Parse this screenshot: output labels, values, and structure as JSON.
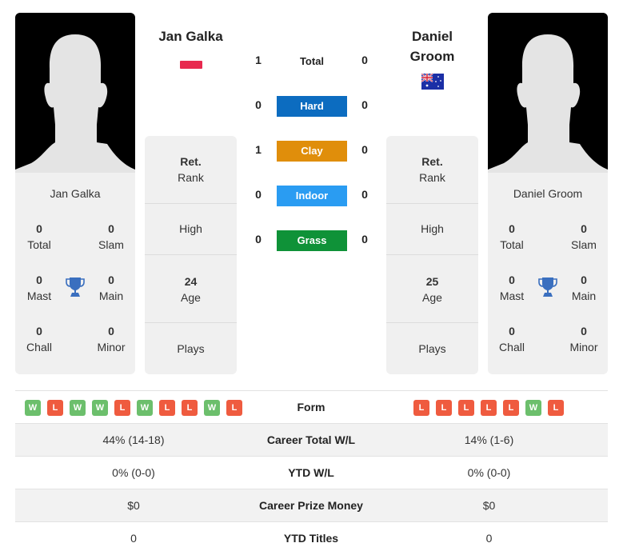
{
  "player1": {
    "name": "Jan Galka",
    "card_name": "Jan Galka",
    "flag": "poland",
    "stats": {
      "total": {
        "value": "0",
        "label": "Total"
      },
      "slam": {
        "value": "0",
        "label": "Slam"
      },
      "mast": {
        "value": "0",
        "label": "Mast"
      },
      "main": {
        "value": "0",
        "label": "Main"
      },
      "chall": {
        "value": "0",
        "label": "Chall"
      },
      "minor": {
        "value": "0",
        "label": "Minor"
      }
    },
    "rank": {
      "value": "Ret.",
      "label": "Rank"
    },
    "high": {
      "label": "High"
    },
    "age": {
      "value": "24",
      "label": "Age"
    },
    "plays": {
      "label": "Plays"
    },
    "form": [
      "W",
      "L",
      "W",
      "W",
      "L",
      "W",
      "L",
      "L",
      "W",
      "L"
    ],
    "career_wl": "44% (14-18)",
    "ytd_wl": "0% (0-0)",
    "prize_money": "$0",
    "ytd_titles": "0"
  },
  "player2": {
    "name_line1": "Daniel",
    "name_line2": "Groom",
    "card_name": "Daniel Groom",
    "flag": "australia",
    "stats": {
      "total": {
        "value": "0",
        "label": "Total"
      },
      "slam": {
        "value": "0",
        "label": "Slam"
      },
      "mast": {
        "value": "0",
        "label": "Mast"
      },
      "main": {
        "value": "0",
        "label": "Main"
      },
      "chall": {
        "value": "0",
        "label": "Chall"
      },
      "minor": {
        "value": "0",
        "label": "Minor"
      }
    },
    "rank": {
      "value": "Ret.",
      "label": "Rank"
    },
    "high": {
      "label": "High"
    },
    "age": {
      "value": "25",
      "label": "Age"
    },
    "plays": {
      "label": "Plays"
    },
    "form": [
      "L",
      "L",
      "L",
      "L",
      "L",
      "W",
      "L"
    ],
    "career_wl": "14% (1-6)",
    "ytd_wl": "0% (0-0)",
    "prize_money": "$0",
    "ytd_titles": "0"
  },
  "h2h": {
    "total": {
      "label": "Total",
      "p1": "1",
      "p2": "0"
    },
    "surfaces": [
      {
        "label": "Hard",
        "p1": "0",
        "p2": "0",
        "color": "#0c6cc0"
      },
      {
        "label": "Clay",
        "p1": "1",
        "p2": "0",
        "color": "#e08e0b"
      },
      {
        "label": "Indoor",
        "p1": "0",
        "p2": "0",
        "color": "#2a9cf2"
      },
      {
        "label": "Grass",
        "p1": "0",
        "p2": "0",
        "color": "#0f9238"
      }
    ]
  },
  "table": {
    "form_label": "Form",
    "career_wl_label": "Career Total W/L",
    "ytd_wl_label": "YTD W/L",
    "prize_label": "Career Prize Money",
    "titles_label": "YTD Titles"
  },
  "icons": {
    "trophy": "trophy-icon",
    "avatar": "silhouette-avatar"
  }
}
